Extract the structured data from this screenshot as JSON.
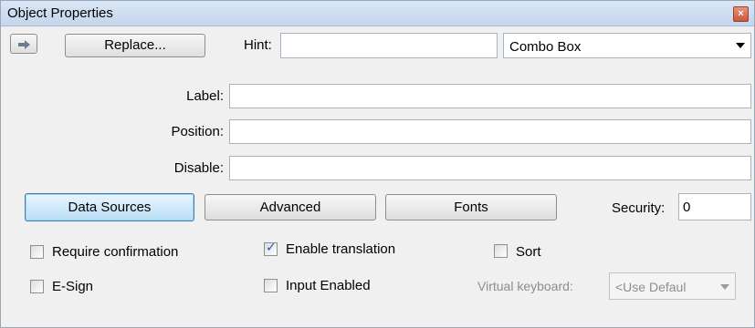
{
  "window": {
    "title": "Object Properties"
  },
  "toolbar": {
    "replace_label": "Replace...",
    "hint_label": "Hint:",
    "hint_value": "",
    "type_selected": "Combo Box"
  },
  "fields": {
    "label_label": "Label:",
    "label_value": "",
    "position_label": "Position:",
    "position_value": "",
    "disable_label": "Disable:",
    "disable_value": ""
  },
  "tabs": {
    "data_sources": "Data Sources",
    "advanced": "Advanced",
    "fonts": "Fonts"
  },
  "security": {
    "label": "Security:",
    "value": "0"
  },
  "options": {
    "require_confirmation": {
      "label": "Require confirmation",
      "checked": false
    },
    "enable_translation": {
      "label": "Enable translation",
      "checked": true
    },
    "sort": {
      "label": "Sort",
      "checked": false
    },
    "e_sign": {
      "label": "E-Sign",
      "checked": false
    },
    "input_enabled": {
      "label": "Input Enabled",
      "checked": false
    }
  },
  "virtual_keyboard": {
    "label": "Virtual keyboard:",
    "selected": "<Use Defaul"
  },
  "colors": {
    "accent": "#b9def7",
    "title_bar": "#c4d6ec",
    "panel": "#f0f0f0"
  }
}
